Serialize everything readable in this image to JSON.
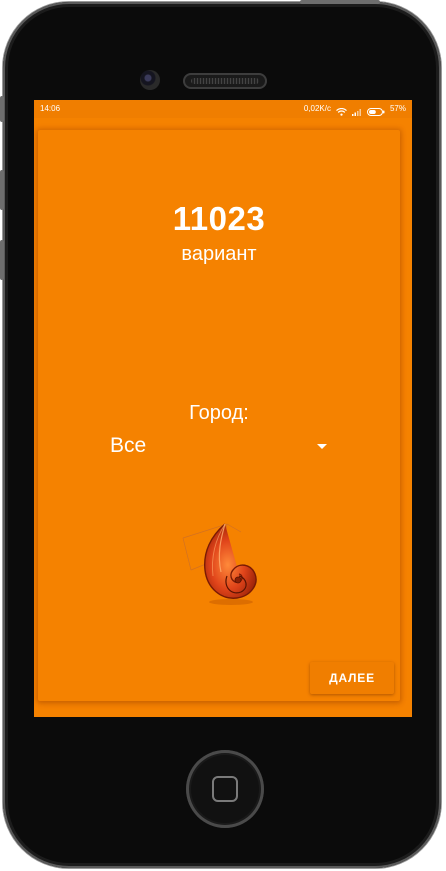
{
  "status_bar": {
    "time": "14:06",
    "network_speed": "0,02K/c",
    "battery_percent": "57%",
    "battery_level": 0.57,
    "icons": [
      "wifi-icon",
      "signal-icon",
      "battery-icon"
    ]
  },
  "main": {
    "variant_number": "11023",
    "variant_label": "вариант",
    "city_label": "Город:",
    "city_select": {
      "selected": "Все",
      "icon": "dropdown-arrow-icon"
    },
    "logo": "shell-logo",
    "next_button_label": "ДАЛЕЕ"
  },
  "colors": {
    "background": "#f58200",
    "status_bar": "#f07e00",
    "text": "#ffffff"
  }
}
